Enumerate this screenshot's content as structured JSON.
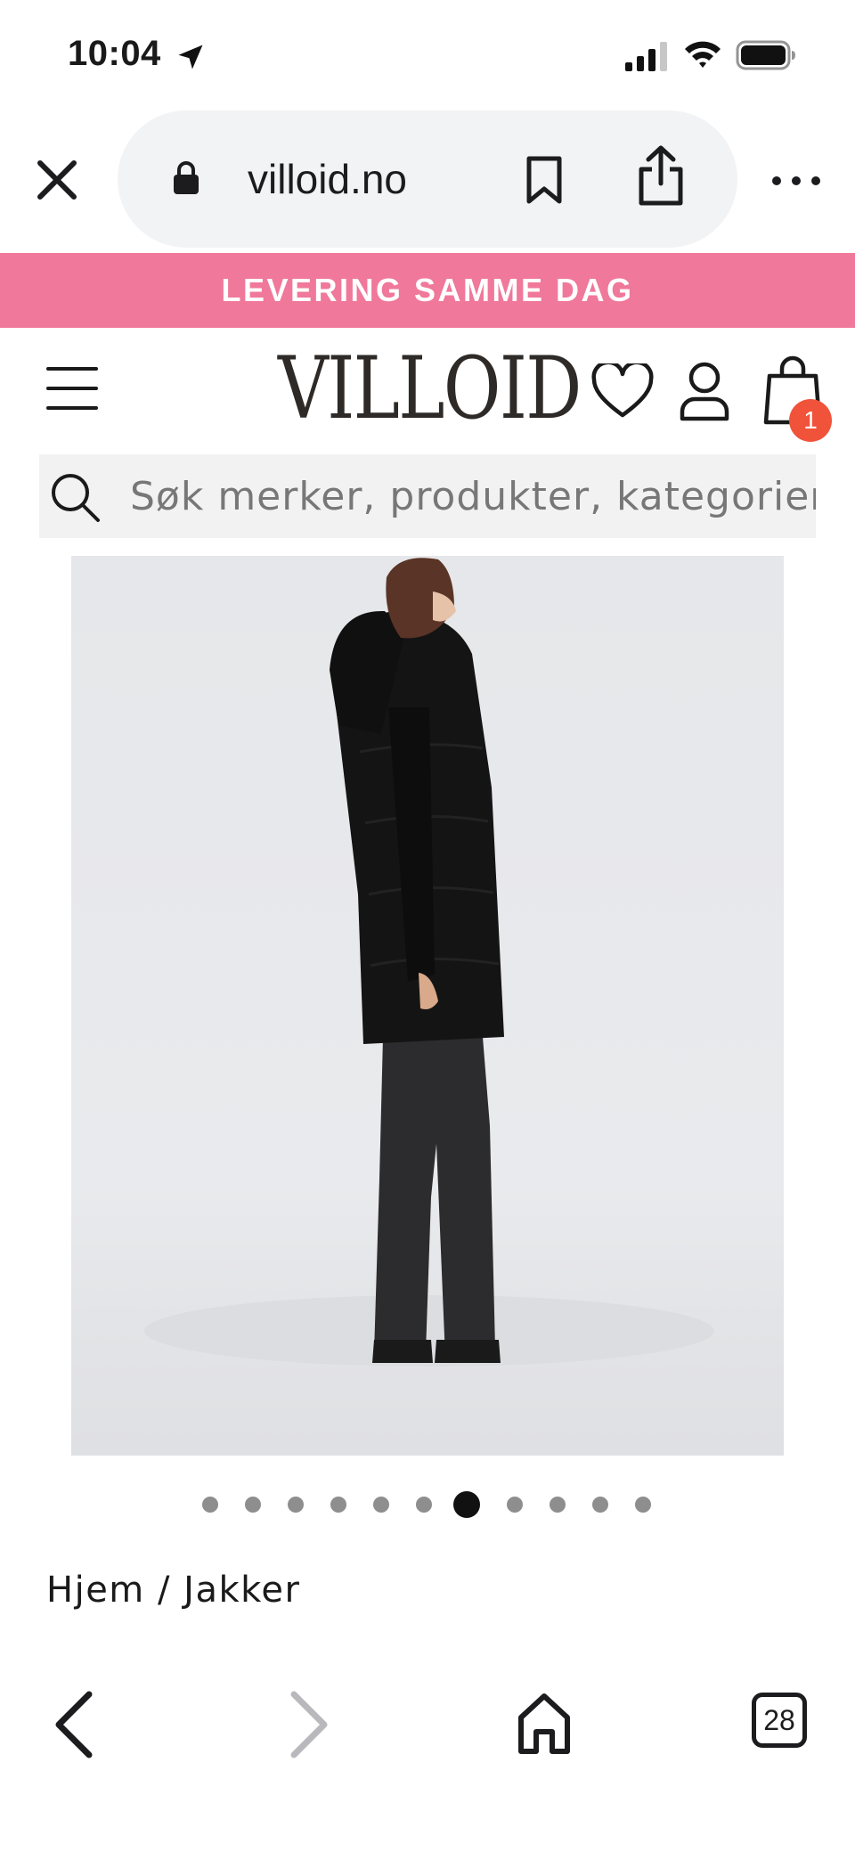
{
  "status_bar": {
    "time": "10:04",
    "location_icon": "location-arrow-icon",
    "signal_icon": "cellular-signal-icon",
    "wifi_icon": "wifi-icon",
    "battery_icon": "battery-icon"
  },
  "browser": {
    "close_icon": "close-icon",
    "url": "villoid.no",
    "lock_icon": "lock-icon",
    "bookmark_icon": "bookmark-icon",
    "share_icon": "share-icon",
    "more_icon": "more-icon"
  },
  "banner": {
    "text": "LEVERING SAMME DAG",
    "color": "#f0789a"
  },
  "header": {
    "menu_icon": "hamburger-menu-icon",
    "logo": "VILLOID",
    "wishlist_icon": "heart-icon",
    "account_icon": "user-icon",
    "cart_icon": "shopping-bag-icon",
    "cart_count": "1",
    "badge_color": "#f0533a"
  },
  "search": {
    "placeholder": "Søk merker, produkter, kategorier"
  },
  "product_gallery": {
    "total_images": 11,
    "active_index": 6
  },
  "breadcrumb": "Hjem / Jakker",
  "toolbar": {
    "back_icon": "chevron-left-icon",
    "forward_icon": "chevron-right-icon",
    "home_icon": "home-icon",
    "tabs_count": "28"
  }
}
